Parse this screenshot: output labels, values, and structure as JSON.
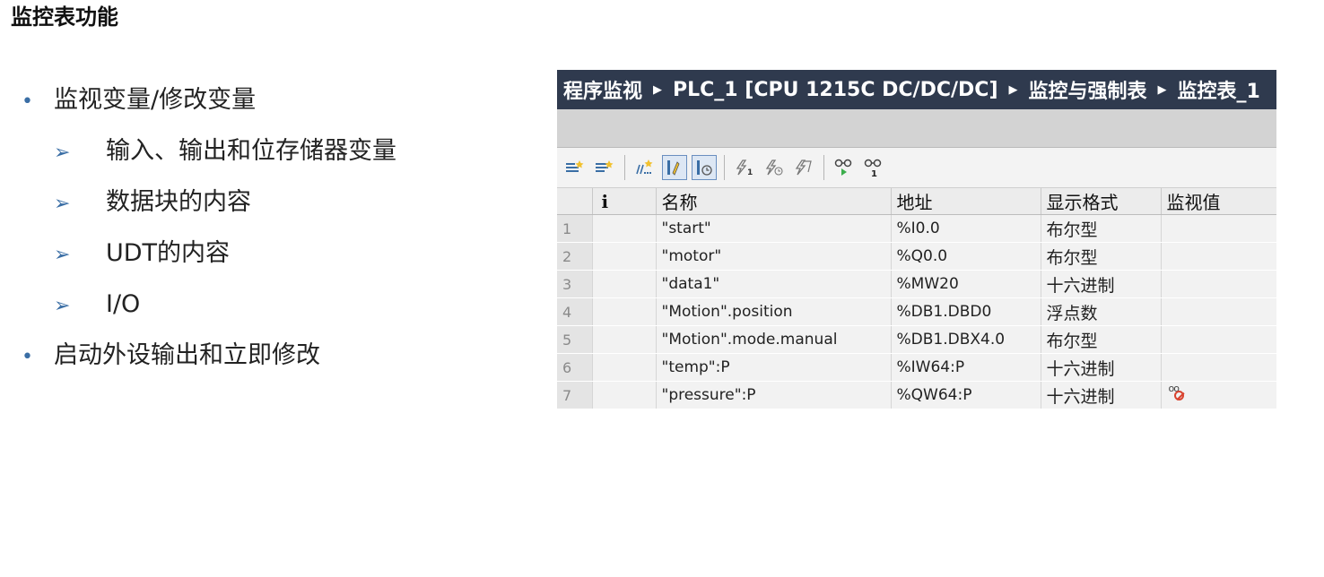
{
  "slide": {
    "title": "监控表功能",
    "bullets": [
      {
        "text": "监视变量/修改变量",
        "subs": [
          "输入、输出和位存储器变量",
          "数据块的内容",
          "UDT的内容",
          "I/O"
        ]
      },
      {
        "text": "启动外设输出和立即修改",
        "subs": []
      }
    ]
  },
  "panel": {
    "breadcrumb": [
      "程序监视",
      "PLC_1 [CPU 1215C DC/DC/DC]",
      "监控与强制表",
      "监控表_1"
    ],
    "toolbar_icons": [
      "insert-row-icon",
      "add-row-icon",
      "insert-comment-row-icon",
      "monitor-all-icon",
      "monitor-now-icon",
      "modify-now-icon",
      "modify-trigger-icon",
      "enable-peripheral-output-icon",
      "monitor-continuous-icon",
      "monitor-once-icon"
    ],
    "columns": {
      "index": "",
      "info": "i",
      "name": "名称",
      "address": "地址",
      "format": "显示格式",
      "monitor": "监视值"
    },
    "rows": [
      {
        "index": "1",
        "name": "\"start\"",
        "address": "%I0.0",
        "format": "布尔型",
        "monitor": ""
      },
      {
        "index": "2",
        "name": "\"motor\"",
        "address": "%Q0.0",
        "format": "布尔型",
        "monitor": ""
      },
      {
        "index": "3",
        "name": "\"data1\"",
        "address": "%MW20",
        "format": "十六进制",
        "monitor": ""
      },
      {
        "index": "4",
        "name": "\"Motion\".position",
        "address": "%DB1.DBD0",
        "format": "浮点数",
        "monitor": ""
      },
      {
        "index": "5",
        "name": "\"Motion\".mode.manual",
        "address": "%DB1.DBX4.0",
        "format": "布尔型",
        "monitor": ""
      },
      {
        "index": "6",
        "name": "\"temp\":P",
        "address": "%IW64:P",
        "format": "十六进制",
        "monitor": ""
      },
      {
        "index": "7",
        "name": "\"pressure\":P",
        "address": "%QW64:P",
        "format": "十六进制",
        "monitor": "monitoring-disabled-icon"
      }
    ]
  }
}
